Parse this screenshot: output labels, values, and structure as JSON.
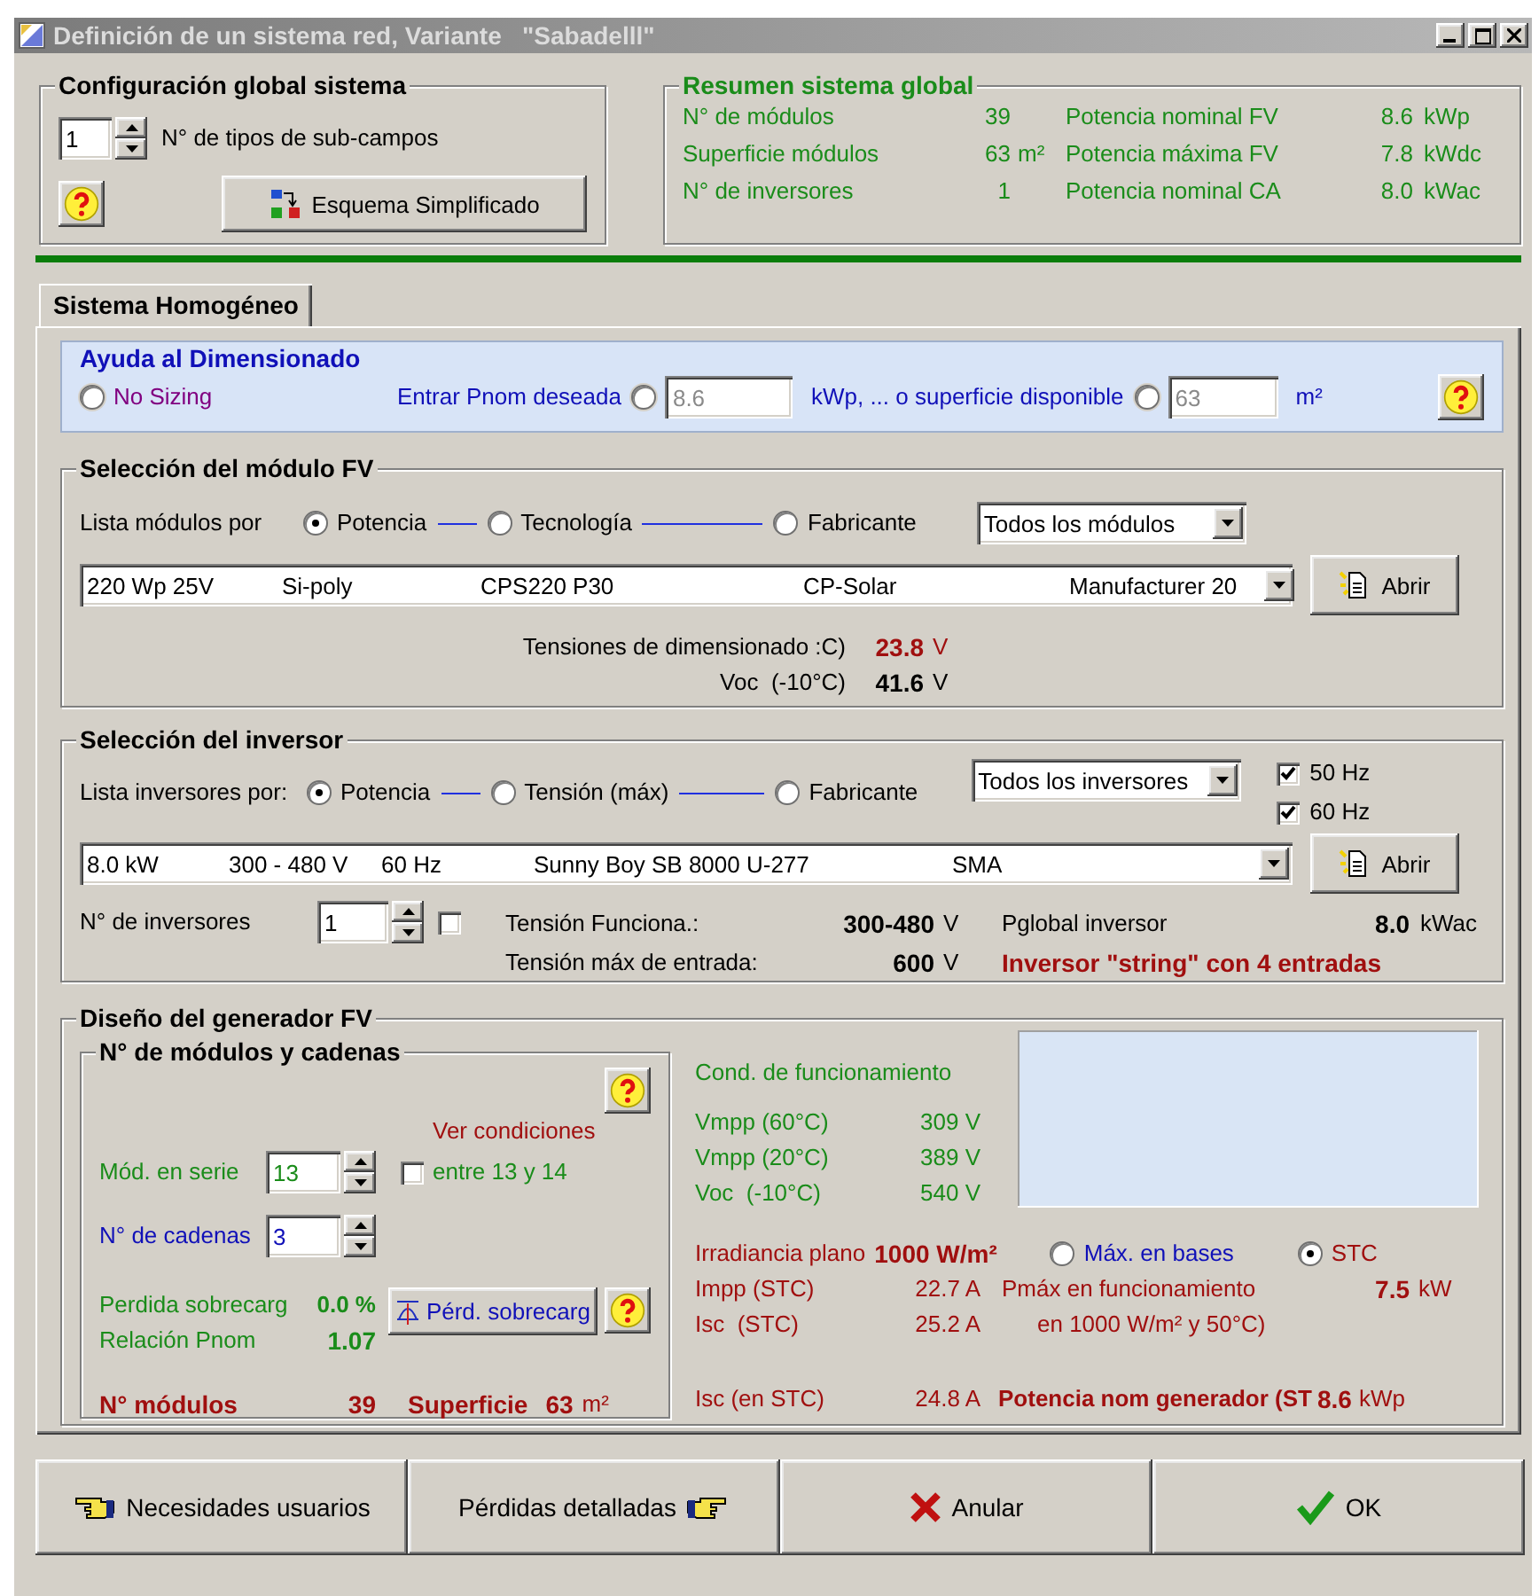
{
  "window": {
    "title": "Definición de un sistema red, Variante   \"Sabadelll\""
  },
  "global_config": {
    "title": "Configuración global sistema",
    "subfield_count": "1",
    "subfield_label": "N° de tipos de sub-campos",
    "schema_button": "Esquema Simplificado"
  },
  "summary": {
    "title": "Resumen sistema global",
    "rows": [
      {
        "label": "N° de módulos",
        "value": "39",
        "label2": "Potencia nominal FV",
        "value2": "8.6",
        "unit2": "kWp"
      },
      {
        "label": "Superficie módulos",
        "value": "63",
        "unit": "m²",
        "label2": "Potencia máxima FV",
        "value2": "7.8",
        "unit2": "kWdc"
      },
      {
        "label": "N° de inversores",
        "value": "1",
        "label2": "Potencia nominal CA",
        "value2": "8.0",
        "unit2": "kWac"
      }
    ]
  },
  "tabs": [
    {
      "label": "Sistema Homogéneo",
      "selected": true
    }
  ],
  "sizing": {
    "title": "Ayuda al Dimensionado",
    "no_sizing": {
      "label": "No Sizing",
      "selected": false
    },
    "pnom": {
      "label": "Entrar Pnom deseada",
      "selected": false,
      "disabled": true,
      "value": "8.6",
      "unit": "kWp, ... o superficie disponible"
    },
    "area": {
      "selected": false,
      "disabled": true,
      "value": "63",
      "unit": "m²"
    }
  },
  "module": {
    "title": "Selección del módulo FV",
    "sort_label": "Lista módulos por",
    "sort_options": [
      {
        "label": "Potencia",
        "selected": true
      },
      {
        "label": "Tecnología",
        "selected": false
      },
      {
        "label": "Fabricante",
        "selected": false
      }
    ],
    "filter": "Todos los módulos",
    "selection": [
      "220 Wp 25V",
      "Si-poly",
      "CPS220 P30",
      "CP-Solar",
      "Manufacturer 20"
    ],
    "open_button": "Abrir",
    "readings": [
      {
        "label": "Tensiones de dimensionado :C)",
        "value": "23.8",
        "unit": "V",
        "kind": "alert"
      },
      {
        "label": "Voc  (-10°C)",
        "value": "41.6",
        "unit": "V",
        "kind": "normal"
      }
    ]
  },
  "inverter": {
    "title": "Selección del inversor",
    "sort_label": "Lista inversores por:",
    "sort_options": [
      {
        "label": "Potencia",
        "selected": true
      },
      {
        "label": "Tensión (máx)",
        "selected": false
      },
      {
        "label": "Fabricante",
        "selected": false
      }
    ],
    "filter": "Todos los inversores",
    "frequencies": [
      {
        "label": "50 Hz",
        "checked": true
      },
      {
        "label": "60 Hz",
        "checked": true
      }
    ],
    "selection": [
      "8.0 kW",
      "300 - 480 V",
      "60 Hz",
      "Sunny Boy SB 8000 U-277",
      "SMA"
    ],
    "open_button": "Abrir",
    "count_label": "N° de inversores",
    "count": "1",
    "count_checked": false,
    "specs": [
      {
        "label": "Tensión Funciona.:",
        "value": "300-480",
        "unit": "V"
      },
      {
        "label": "Tensión máx de entrada:",
        "value": "600",
        "unit": "V"
      }
    ],
    "pglobal": {
      "label": "Pglobal inversor",
      "value": "8.0",
      "unit": "kWac"
    },
    "warning": "Inversor \"string\" con 4 entradas"
  },
  "generator": {
    "title": "Diseño del generador FV",
    "strings": {
      "title": "N° de módulos y cadenas",
      "see_conditions": "Ver condiciones",
      "series_label": "Mód. en serie",
      "series": "13",
      "range_checked": false,
      "range_label": "entre 13 y 14",
      "strings_label": "N° de cadenas",
      "strings": "3",
      "loss_label": "Perdida sobrecarg",
      "loss_value": "0.0 %",
      "ratio_label": "Relación Pnom",
      "ratio_value": "1.07",
      "loss_button": "Pérd. sobrecarg",
      "modules_label": "N° módulos",
      "modules_value": "39",
      "area_label": "Superficie",
      "area_value": "63",
      "area_unit": "m²"
    },
    "operating": {
      "title": "Cond. de funcionamiento",
      "rows": [
        {
          "label": "Vmpp (60°C)",
          "value": "309 V"
        },
        {
          "label": "Vmpp (20°C)",
          "value": "389 V"
        },
        {
          "label": "Voc  (-10°C)",
          "value": "540 V"
        }
      ],
      "irradiance_label": "Irradiancia plano",
      "irradiance_value": "1000 W/m²",
      "modes": [
        {
          "label": "Máx. en bases",
          "selected": false
        },
        {
          "label": "STC",
          "selected": true
        }
      ],
      "impp": {
        "label": "Impp (STC)",
        "value": "22.7 A"
      },
      "isc": {
        "label": "Isc  (STC)",
        "value": "25.2 A"
      },
      "pmax": {
        "label": "Pmáx en funcionamiento",
        "value": "7.5",
        "unit": "kW",
        "note": "en 1000 W/m² y 50°C)"
      },
      "isc_total": {
        "label": "Isc (en STC)",
        "value": "24.8 A"
      },
      "nominal": {
        "label": "Potencia nom generador (ST",
        "value": "8.6",
        "unit": "kWp"
      }
    }
  },
  "buttons": [
    {
      "label": "Necesidades usuarios",
      "kind": "back"
    },
    {
      "label": "Pérdidas detalladas",
      "kind": "forward"
    },
    {
      "label": "Anular",
      "kind": "cancel"
    },
    {
      "label": "OK",
      "kind": "ok"
    }
  ]
}
